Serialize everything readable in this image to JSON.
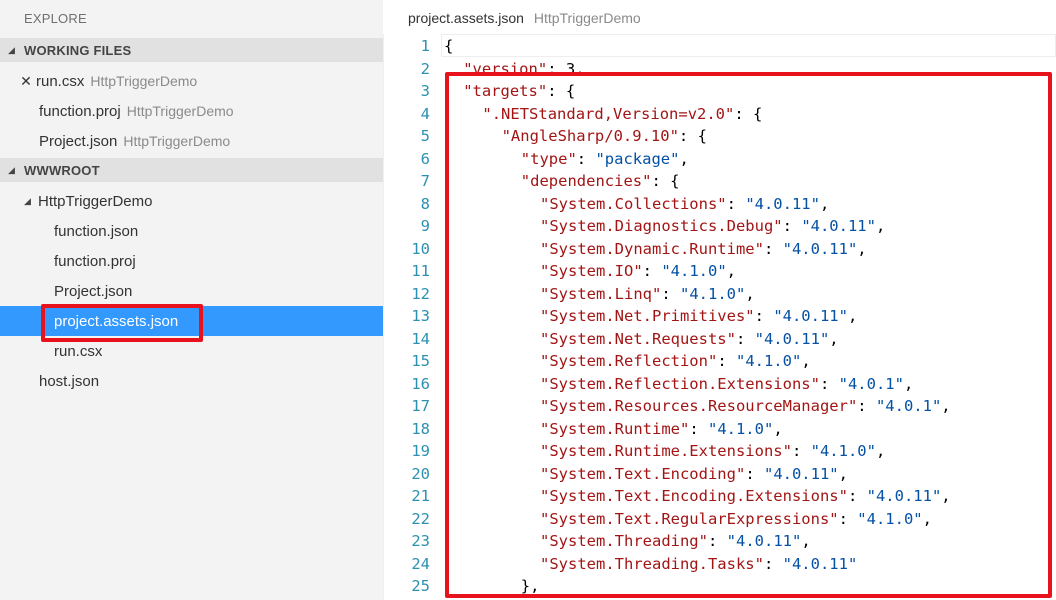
{
  "sidebar": {
    "title": "EXPLORE",
    "working_files": {
      "header": "WORKING FILES",
      "items": [
        {
          "name": "run.csx",
          "folder": "HttpTriggerDemo"
        },
        {
          "name": "function.proj",
          "folder": "HttpTriggerDemo"
        },
        {
          "name": "Project.json",
          "folder": "HttpTriggerDemo"
        }
      ]
    },
    "wwwroot": {
      "header": "WWWROOT",
      "folder": "HttpTriggerDemo",
      "files": [
        "function.json",
        "function.proj",
        "Project.json",
        "project.assets.json",
        "run.csx"
      ],
      "root_files": [
        "host.json"
      ]
    }
  },
  "editor": {
    "file_name": "project.assets.json",
    "folder": "HttpTriggerDemo"
  },
  "colors": {
    "highlight_border": "#e8121d",
    "selection": "#3399ff",
    "json_key": "#a31515",
    "json_string": "#0451a5",
    "line_number": "#2b91af"
  },
  "icons": {
    "close": "close-icon",
    "expanded": "triangle-down-icon"
  },
  "code_lines": [
    {
      "n": "1",
      "indent": 0,
      "tokens": [
        {
          "t": "p",
          "v": "{"
        }
      ]
    },
    {
      "n": "2",
      "indent": 1,
      "tokens": [
        {
          "t": "k",
          "v": "\"version\""
        },
        {
          "t": "p",
          "v": ": "
        },
        {
          "t": "p",
          "v": "3,"
        }
      ]
    },
    {
      "n": "3",
      "indent": 1,
      "tokens": [
        {
          "t": "k",
          "v": "\"targets\""
        },
        {
          "t": "p",
          "v": ": {"
        }
      ]
    },
    {
      "n": "4",
      "indent": 2,
      "tokens": [
        {
          "t": "k",
          "v": "\".NETStandard,Version=v2.0\""
        },
        {
          "t": "p",
          "v": ": {"
        }
      ]
    },
    {
      "n": "5",
      "indent": 3,
      "tokens": [
        {
          "t": "k",
          "v": "\"AngleSharp/0.9.10\""
        },
        {
          "t": "p",
          "v": ": {"
        }
      ]
    },
    {
      "n": "6",
      "indent": 4,
      "tokens": [
        {
          "t": "k",
          "v": "\"type\""
        },
        {
          "t": "p",
          "v": ": "
        },
        {
          "t": "s",
          "v": "\"package\""
        },
        {
          "t": "p",
          "v": ","
        }
      ]
    },
    {
      "n": "7",
      "indent": 4,
      "tokens": [
        {
          "t": "k",
          "v": "\"dependencies\""
        },
        {
          "t": "p",
          "v": ": {"
        }
      ]
    },
    {
      "n": "8",
      "indent": 5,
      "tokens": [
        {
          "t": "k",
          "v": "\"System.Collections\""
        },
        {
          "t": "p",
          "v": ": "
        },
        {
          "t": "s",
          "v": "\"4.0.11\""
        },
        {
          "t": "p",
          "v": ","
        }
      ]
    },
    {
      "n": "9",
      "indent": 5,
      "tokens": [
        {
          "t": "k",
          "v": "\"System.Diagnostics.Debug\""
        },
        {
          "t": "p",
          "v": ": "
        },
        {
          "t": "s",
          "v": "\"4.0.11\""
        },
        {
          "t": "p",
          "v": ","
        }
      ]
    },
    {
      "n": "10",
      "indent": 5,
      "tokens": [
        {
          "t": "k",
          "v": "\"System.Dynamic.Runtime\""
        },
        {
          "t": "p",
          "v": ": "
        },
        {
          "t": "s",
          "v": "\"4.0.11\""
        },
        {
          "t": "p",
          "v": ","
        }
      ]
    },
    {
      "n": "11",
      "indent": 5,
      "tokens": [
        {
          "t": "k",
          "v": "\"System.IO\""
        },
        {
          "t": "p",
          "v": ": "
        },
        {
          "t": "s",
          "v": "\"4.1.0\""
        },
        {
          "t": "p",
          "v": ","
        }
      ]
    },
    {
      "n": "12",
      "indent": 5,
      "tokens": [
        {
          "t": "k",
          "v": "\"System.Linq\""
        },
        {
          "t": "p",
          "v": ": "
        },
        {
          "t": "s",
          "v": "\"4.1.0\""
        },
        {
          "t": "p",
          "v": ","
        }
      ]
    },
    {
      "n": "13",
      "indent": 5,
      "tokens": [
        {
          "t": "k",
          "v": "\"System.Net.Primitives\""
        },
        {
          "t": "p",
          "v": ": "
        },
        {
          "t": "s",
          "v": "\"4.0.11\""
        },
        {
          "t": "p",
          "v": ","
        }
      ]
    },
    {
      "n": "14",
      "indent": 5,
      "tokens": [
        {
          "t": "k",
          "v": "\"System.Net.Requests\""
        },
        {
          "t": "p",
          "v": ": "
        },
        {
          "t": "s",
          "v": "\"4.0.11\""
        },
        {
          "t": "p",
          "v": ","
        }
      ]
    },
    {
      "n": "15",
      "indent": 5,
      "tokens": [
        {
          "t": "k",
          "v": "\"System.Reflection\""
        },
        {
          "t": "p",
          "v": ": "
        },
        {
          "t": "s",
          "v": "\"4.1.0\""
        },
        {
          "t": "p",
          "v": ","
        }
      ]
    },
    {
      "n": "16",
      "indent": 5,
      "tokens": [
        {
          "t": "k",
          "v": "\"System.Reflection.Extensions\""
        },
        {
          "t": "p",
          "v": ": "
        },
        {
          "t": "s",
          "v": "\"4.0.1\""
        },
        {
          "t": "p",
          "v": ","
        }
      ]
    },
    {
      "n": "17",
      "indent": 5,
      "tokens": [
        {
          "t": "k",
          "v": "\"System.Resources.ResourceManager\""
        },
        {
          "t": "p",
          "v": ": "
        },
        {
          "t": "s",
          "v": "\"4.0.1\""
        },
        {
          "t": "p",
          "v": ","
        }
      ]
    },
    {
      "n": "18",
      "indent": 5,
      "tokens": [
        {
          "t": "k",
          "v": "\"System.Runtime\""
        },
        {
          "t": "p",
          "v": ": "
        },
        {
          "t": "s",
          "v": "\"4.1.0\""
        },
        {
          "t": "p",
          "v": ","
        }
      ]
    },
    {
      "n": "19",
      "indent": 5,
      "tokens": [
        {
          "t": "k",
          "v": "\"System.Runtime.Extensions\""
        },
        {
          "t": "p",
          "v": ": "
        },
        {
          "t": "s",
          "v": "\"4.1.0\""
        },
        {
          "t": "p",
          "v": ","
        }
      ]
    },
    {
      "n": "20",
      "indent": 5,
      "tokens": [
        {
          "t": "k",
          "v": "\"System.Text.Encoding\""
        },
        {
          "t": "p",
          "v": ": "
        },
        {
          "t": "s",
          "v": "\"4.0.11\""
        },
        {
          "t": "p",
          "v": ","
        }
      ]
    },
    {
      "n": "21",
      "indent": 5,
      "tokens": [
        {
          "t": "k",
          "v": "\"System.Text.Encoding.Extensions\""
        },
        {
          "t": "p",
          "v": ": "
        },
        {
          "t": "s",
          "v": "\"4.0.11\""
        },
        {
          "t": "p",
          "v": ","
        }
      ]
    },
    {
      "n": "22",
      "indent": 5,
      "tokens": [
        {
          "t": "k",
          "v": "\"System.Text.RegularExpressions\""
        },
        {
          "t": "p",
          "v": ": "
        },
        {
          "t": "s",
          "v": "\"4.1.0\""
        },
        {
          "t": "p",
          "v": ","
        }
      ]
    },
    {
      "n": "23",
      "indent": 5,
      "tokens": [
        {
          "t": "k",
          "v": "\"System.Threading\""
        },
        {
          "t": "p",
          "v": ": "
        },
        {
          "t": "s",
          "v": "\"4.0.11\""
        },
        {
          "t": "p",
          "v": ","
        }
      ]
    },
    {
      "n": "24",
      "indent": 5,
      "tokens": [
        {
          "t": "k",
          "v": "\"System.Threading.Tasks\""
        },
        {
          "t": "p",
          "v": ": "
        },
        {
          "t": "s",
          "v": "\"4.0.11\""
        }
      ]
    },
    {
      "n": "25",
      "indent": 4,
      "tokens": [
        {
          "t": "p",
          "v": "},"
        }
      ]
    }
  ]
}
